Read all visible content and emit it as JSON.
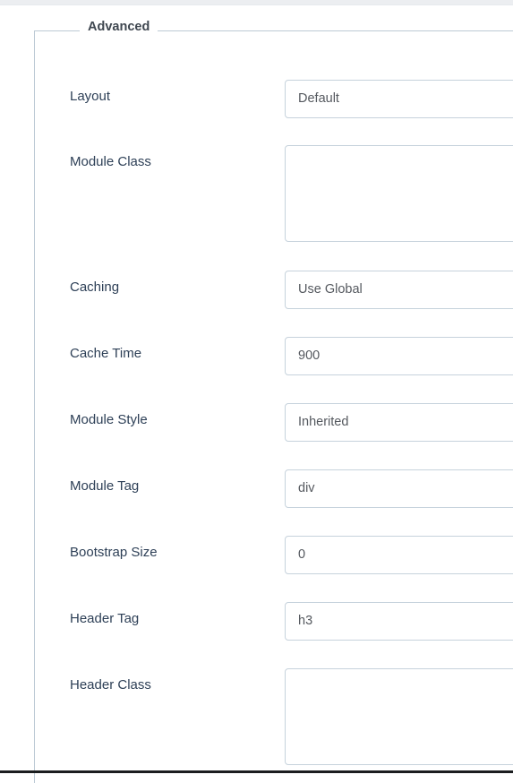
{
  "window": {
    "top_band_color": "#eceef1",
    "bottom_rule_color": "#1b1d1f"
  },
  "panel": {
    "legend": "Advanced",
    "border_color": "#bcc9d4"
  },
  "theme": {
    "label_color": "#2e4057",
    "value_color": "#55595f",
    "input_border_color": "#c6d2dc",
    "background": "#ffffff"
  },
  "form": {
    "fields": [
      {
        "id": "layout",
        "label": "Layout",
        "type": "select",
        "value": "Default",
        "placeholder": ""
      },
      {
        "id": "module-class",
        "label": "Module Class",
        "type": "textarea",
        "value": "",
        "placeholder": ""
      },
      {
        "id": "caching",
        "label": "Caching",
        "type": "select",
        "value": "Use Global",
        "placeholder": ""
      },
      {
        "id": "cache-time",
        "label": "Cache Time",
        "type": "number",
        "value": "900",
        "placeholder": ""
      },
      {
        "id": "module-style",
        "label": "Module Style",
        "type": "select",
        "value": "Inherited",
        "placeholder": ""
      },
      {
        "id": "module-tag",
        "label": "Module Tag",
        "type": "select",
        "value": "div",
        "placeholder": ""
      },
      {
        "id": "bootstrap-size",
        "label": "Bootstrap Size",
        "type": "select",
        "value": "0",
        "placeholder": ""
      },
      {
        "id": "header-tag",
        "label": "Header Tag",
        "type": "select",
        "value": "h3",
        "placeholder": ""
      },
      {
        "id": "header-class",
        "label": "Header Class",
        "type": "textarea",
        "value": "",
        "placeholder": ""
      }
    ]
  }
}
